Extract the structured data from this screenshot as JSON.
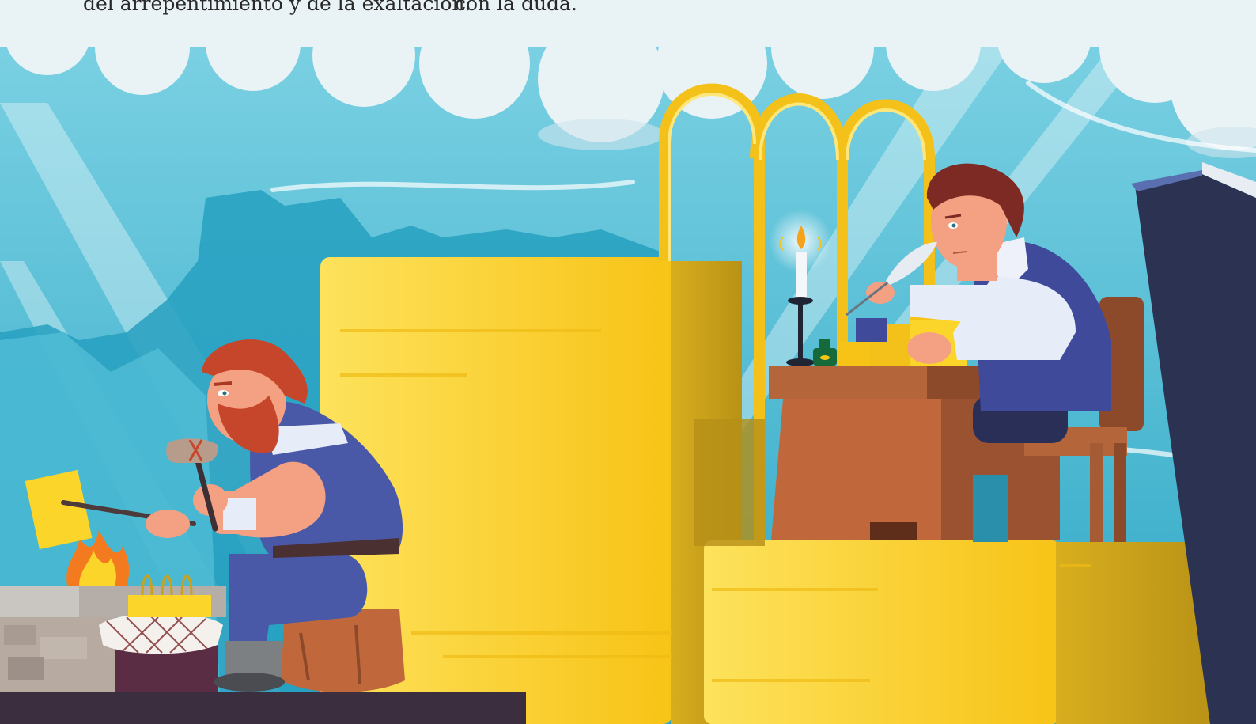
{
  "captions": {
    "left": "del arrepentimiento y de la exaltación.",
    "right": "con la duda."
  },
  "colors": {
    "sky": "#3bb4cf",
    "cloud": "#e9f2f5",
    "gold": "#fcd52a",
    "gold_shadow": "#c9a21d",
    "desk": "#b5653a",
    "vest": "#3f4a9a",
    "beard": "#c6462b",
    "book": "#2c3352"
  },
  "scene": {
    "icons": [
      "cloud-icon",
      "flame-icon",
      "candle-icon",
      "hammer-icon",
      "quill-icon",
      "book-icon"
    ]
  }
}
